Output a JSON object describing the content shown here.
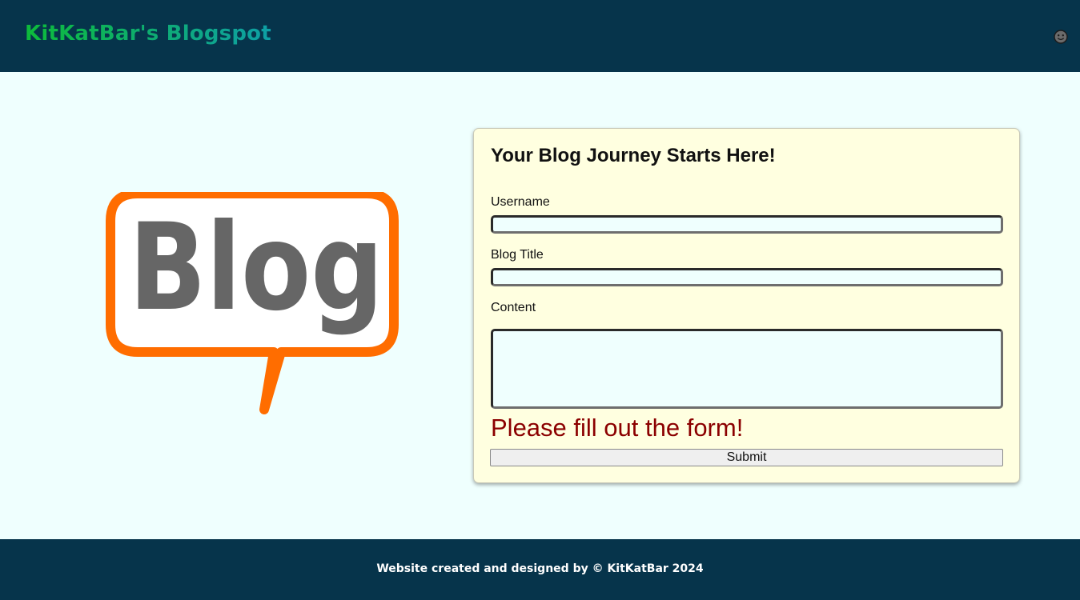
{
  "header": {
    "site_title": "KitKatBar's Blogspot",
    "theme_icon": "smiley-face-icon"
  },
  "logo": {
    "text": "Blog",
    "icon": "blog-speech-bubble-logo"
  },
  "form": {
    "heading": "Your Blog Journey Starts Here!",
    "username_label": "Username",
    "username_value": "",
    "title_label": "Blog Title",
    "title_value": "",
    "content_label": "Content",
    "content_value": "",
    "error_message": "Please fill out the form!",
    "submit_label": "Submit"
  },
  "footer": {
    "text": "Website created and designed by © KitKatBar 2024"
  },
  "colors": {
    "header_bg": "#06344b",
    "page_bg": "#effffe",
    "card_bg": "#ffffe0",
    "error": "#8b0000",
    "logo_orange": "#ff6d00",
    "logo_gray": "#666666"
  }
}
